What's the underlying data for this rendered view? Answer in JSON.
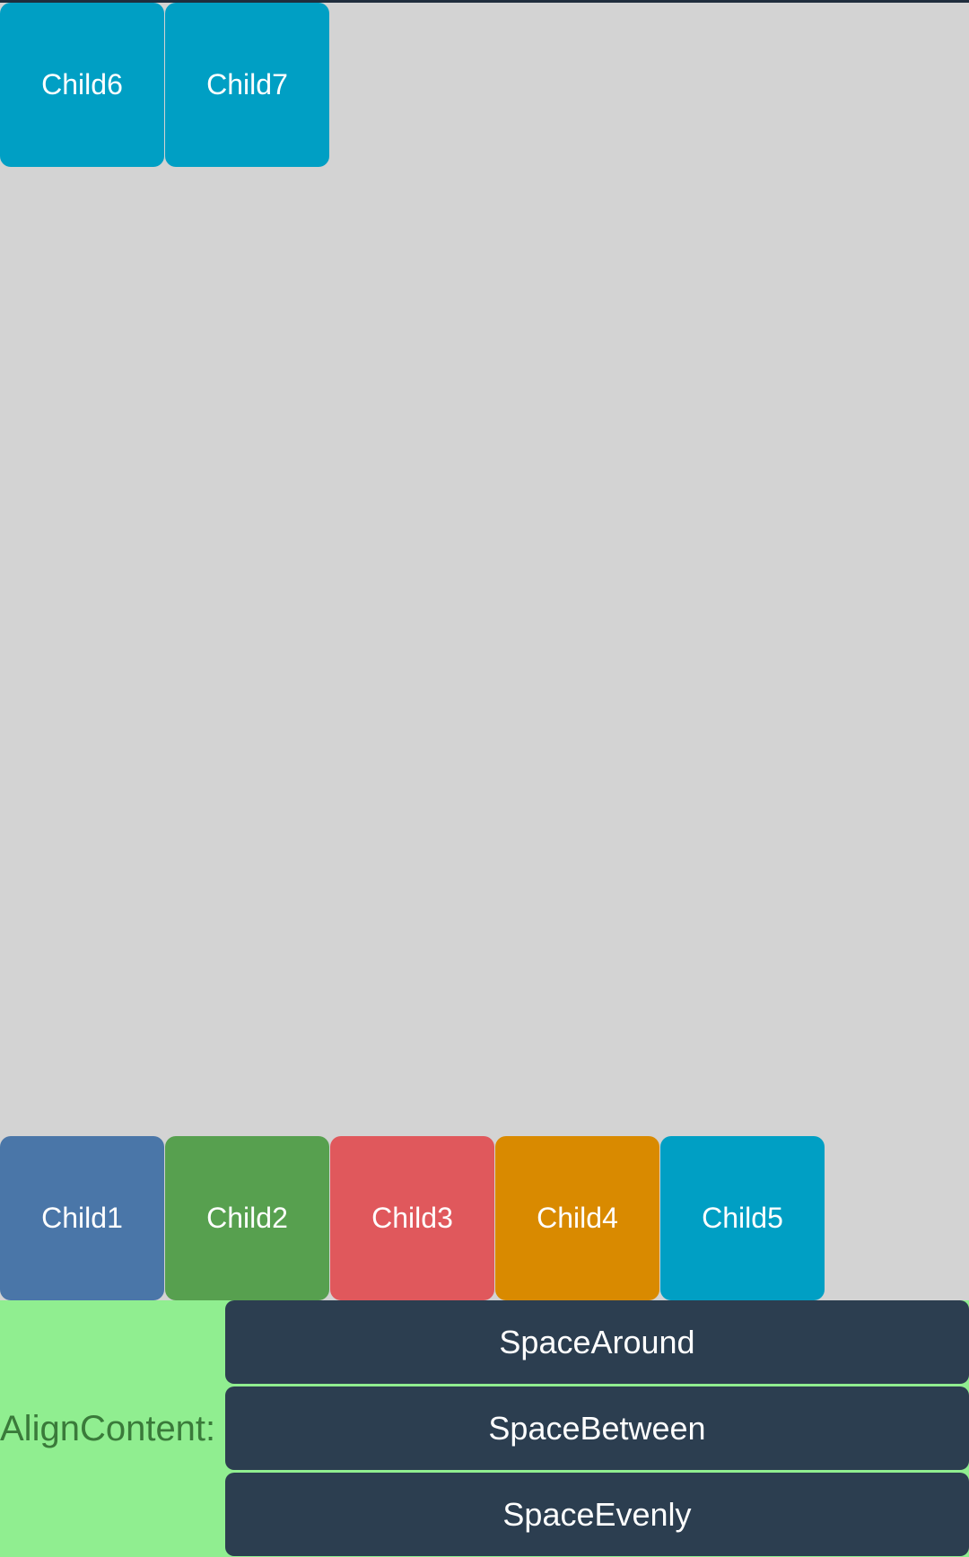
{
  "children_row_wrapped": [
    {
      "label": "Child6",
      "color": "#009fc4"
    },
    {
      "label": "Child7",
      "color": "#009fc4"
    }
  ],
  "children_row_main": [
    {
      "label": "Child1",
      "color": "#4a76a8"
    },
    {
      "label": "Child2",
      "color": "#57a04f"
    },
    {
      "label": "Child3",
      "color": "#e0585c"
    },
    {
      "label": "Child4",
      "color": "#d98a00"
    },
    {
      "label": "Child5",
      "color": "#009fc4"
    }
  ],
  "controls": {
    "label": "AlignContent:",
    "buttons": [
      {
        "label": "SpaceAround"
      },
      {
        "label": "SpaceBetween"
      },
      {
        "label": "SpaceEvenly"
      }
    ],
    "background": "#90ee90",
    "button_color": "#2c3e50"
  }
}
